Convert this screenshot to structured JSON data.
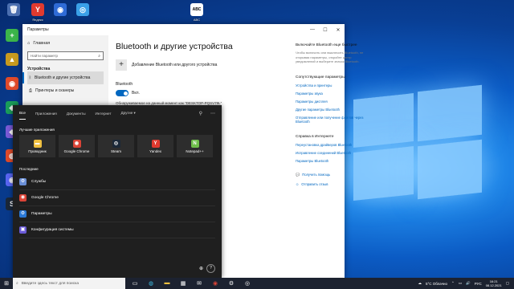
{
  "desktop": {
    "icons": [
      {
        "label": "",
        "glyph": "🗑",
        "color": "#4b6fb0"
      },
      {
        "label": "Яндекс",
        "glyph": "Y",
        "color": "#e03a2f"
      },
      {
        "label": "",
        "glyph": "◉",
        "color": "#2f6bd6"
      },
      {
        "label": "",
        "glyph": "◎",
        "color": "#3aa0e8"
      },
      {
        "label": "ABC",
        "glyph": "ABC",
        "color": "#ffffff"
      },
      {
        "label": "",
        "glyph": "+",
        "color": "#3bb54a"
      },
      {
        "label": "",
        "glyph": "▲",
        "color": "#c79a1f"
      },
      {
        "label": "",
        "glyph": "◉",
        "color": "#e04a2a"
      },
      {
        "label": "",
        "glyph": "◈",
        "color": "#1a9e5a"
      },
      {
        "label": "",
        "glyph": "◆",
        "color": "#7a5ad6"
      },
      {
        "label": "",
        "glyph": "◍",
        "color": "#e04a2a"
      },
      {
        "label": "",
        "glyph": "◉",
        "color": "#5865f2"
      },
      {
        "label": "",
        "glyph": "S",
        "color": "#1b2838"
      }
    ]
  },
  "settings": {
    "window_title": "Параметры",
    "sidebar": {
      "home": "Главная",
      "search_placeholder": "Найти параметр",
      "section": "Устройства",
      "items": [
        {
          "label": "Bluetooth и другие устройства",
          "icon": "bluetooth-icon"
        },
        {
          "label": "Принтеры и сканеры",
          "icon": "printer-icon"
        }
      ]
    },
    "main": {
      "title": "Bluetooth и другие устройства",
      "add_device": "Добавление Bluetooth или другого устройства",
      "bluetooth_label": "Bluetooth",
      "toggle_state": "Вкл.",
      "discover_text": "Обнаруживаемое на данный момент как \"DESKTOP-PQSV79L\""
    },
    "right_panel": {
      "quick_title": "Включайте Bluetooth еще быстрее",
      "quick_text": "Чтобы включить или выключить Bluetooth, не открывая параметры, откройте центр уведомлений и выберите значок Bluetooth.",
      "related_title": "Сопутствующие параметры",
      "related_links": [
        "Устройства и принтеры",
        "Параметры звука",
        "Параметры дисплея",
        "Другие параметры Bluetooth",
        "Отправление или получение файлов через Bluetooth"
      ],
      "help_title": "Справка в Интернете",
      "help_links": [
        "Переустановка драйверов Bluetooth",
        "Исправление соединений Bluetooth",
        "Параметры Bluetooth"
      ],
      "get_help": "Получить помощь",
      "feedback": "Отправить отзыв"
    }
  },
  "start_panel": {
    "tabs": [
      "Все",
      "Приложения",
      "Документы",
      "Интернет",
      "Другие ▾"
    ],
    "best_apps_title": "Лучшие приложения",
    "apps": [
      {
        "label": "Проводник",
        "glyph": "▬",
        "color": "#f0c040"
      },
      {
        "label": "Google Chrome",
        "glyph": "◉",
        "color": "#db4437"
      },
      {
        "label": "Steam",
        "glyph": "◎",
        "color": "#1b2838"
      },
      {
        "label": "Yandex",
        "glyph": "Y",
        "color": "#e03a2f"
      },
      {
        "label": "Notepad++",
        "glyph": "N",
        "color": "#6fbf4b"
      }
    ],
    "recent_title": "Последние",
    "recent": [
      {
        "label": "Службы",
        "glyph": "⚙",
        "color": "#6a8fd6"
      },
      {
        "label": "Google Chrome",
        "glyph": "◉",
        "color": "#db4437"
      },
      {
        "label": "Параметры",
        "glyph": "⚙",
        "color": "#2b79d6"
      },
      {
        "label": "Конфигурация системы",
        "glyph": "▣",
        "color": "#6a5ad6"
      }
    ]
  },
  "taskbar": {
    "search_placeholder": "Введите здесь текст для поиска",
    "weather": "5°C Облачно",
    "lang": "РУС",
    "time": "16:21",
    "date": "08.12.2021"
  }
}
